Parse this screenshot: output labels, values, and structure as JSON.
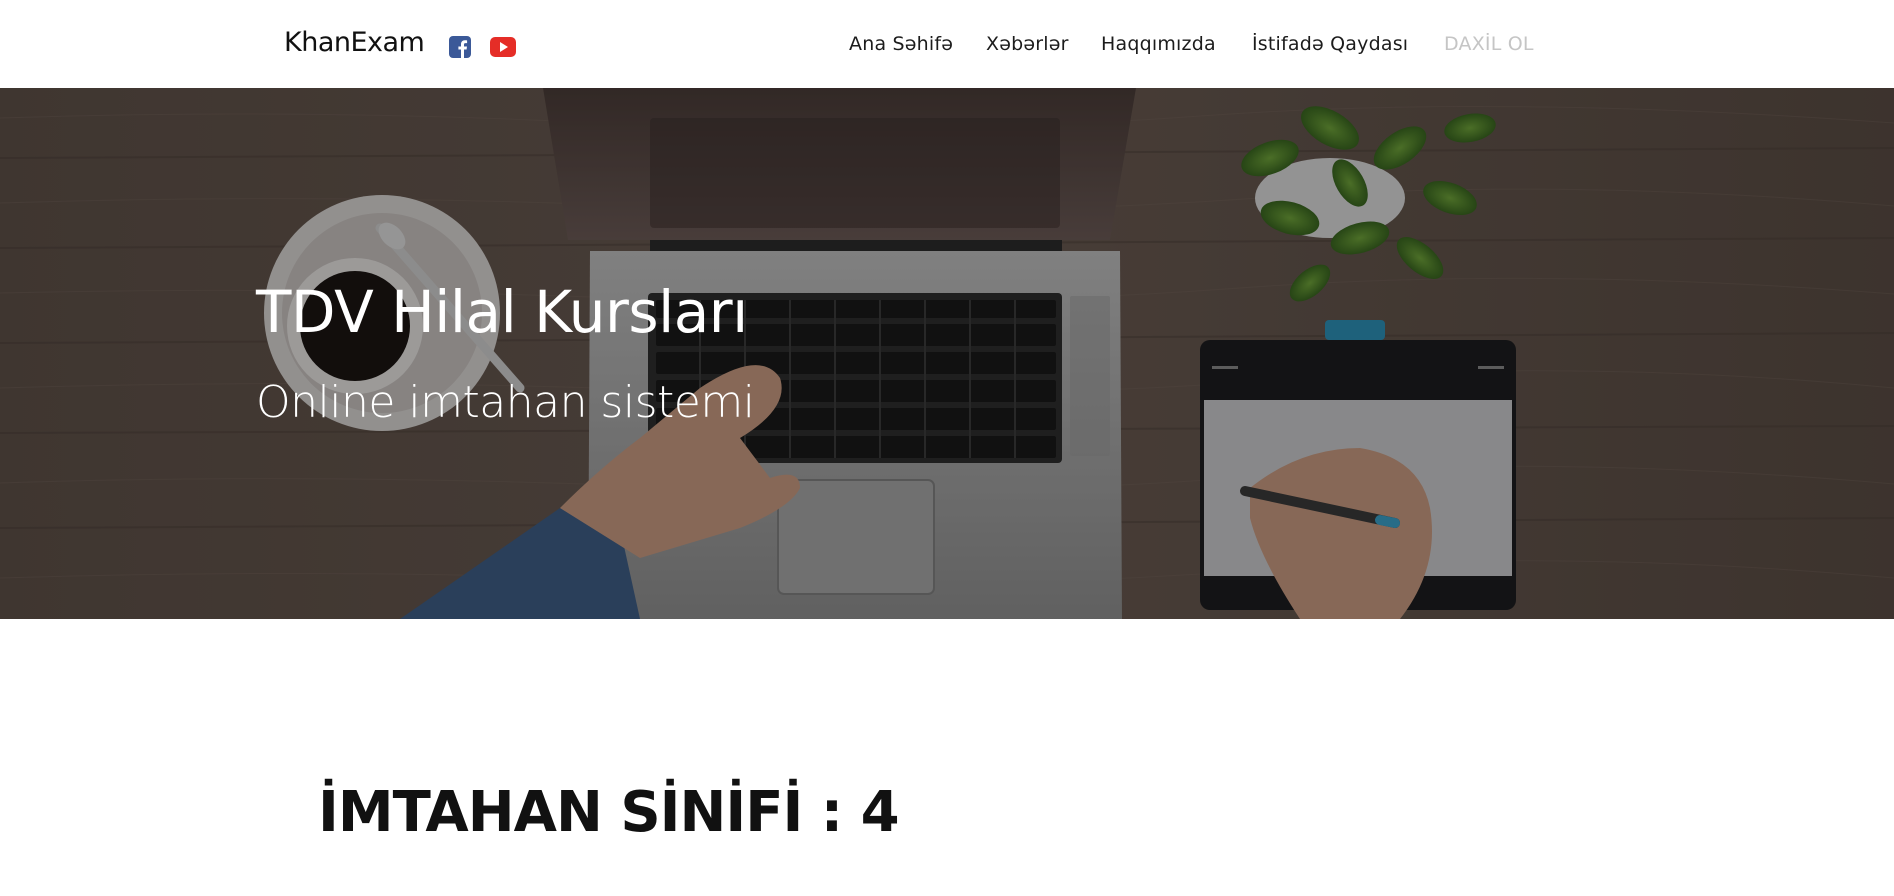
{
  "header": {
    "brand": "KhanExam",
    "social": [
      {
        "name": "facebook",
        "icon": "facebook-icon",
        "color": "#3b5998"
      },
      {
        "name": "youtube",
        "icon": "youtube-icon",
        "color": "#e52d27"
      }
    ],
    "nav": [
      {
        "label": "Ana Səhifə"
      },
      {
        "label": "Xəbərlər"
      },
      {
        "label": "Haqqımızda"
      },
      {
        "label": "İstifadə Qaydası"
      },
      {
        "label": "DAXİL OL"
      }
    ]
  },
  "hero": {
    "title": "TDV Hilal Kursları",
    "subtitle": "Online imtahan sistemi",
    "background": "desk-with-laptop-coffee-plant-tablet-photo",
    "overlay_color": "#000000"
  },
  "main": {
    "exam_class": "İMTAHAN SİNİFİ : 4"
  },
  "colors": {
    "nav_text": "#1c1c1c",
    "nav_muted": "#c5c5c5",
    "hero_text": "#ffffff"
  }
}
